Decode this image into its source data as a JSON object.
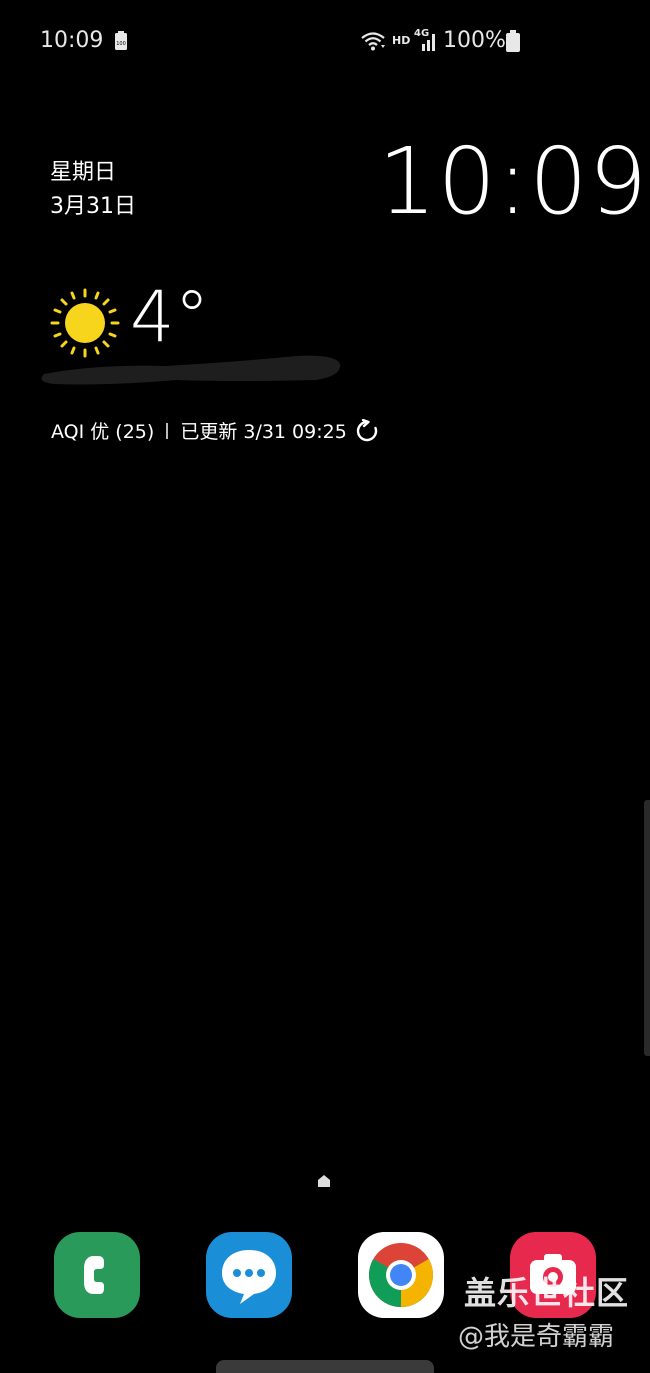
{
  "status_bar": {
    "time": "10:09",
    "network_hd": "HD",
    "network_type": "4G",
    "battery_percent": "100%",
    "battery_small_label": "100",
    "battery_level": 1.0
  },
  "lock_screen": {
    "weekday": "星期日",
    "date": "3月31日",
    "clock": "10:09"
  },
  "weather": {
    "temperature": "4°",
    "icon": "sun-icon",
    "aqi_text": "AQI 优 (25)",
    "updated_text": "已更新 3/31 09:25"
  },
  "dock": {
    "apps": [
      "phone-app",
      "messages-app",
      "chrome-app",
      "camera-app"
    ]
  },
  "watermark": {
    "title": "盖乐世社区",
    "user": "@我是奇霸霸"
  },
  "colors": {
    "background": "#000000",
    "sun": "#f7d51d",
    "phone_app": "#2a9a5a",
    "messages_app": "#1b8ed8",
    "camera_app": "#e8294e"
  }
}
